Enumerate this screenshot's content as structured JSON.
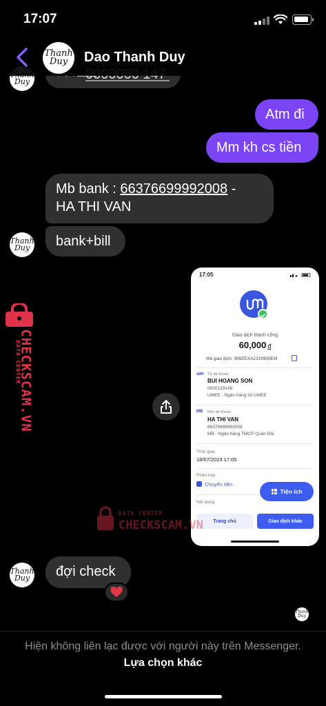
{
  "status_bar": {
    "time": "17:07"
  },
  "header": {
    "contact_name": "Dao Thanh Duy",
    "avatar_line1": "Thanh",
    "avatar_line2": "Duy"
  },
  "messages": [
    {
      "from": "me",
      "text": "Atm đi"
    },
    {
      "from": "me",
      "text": "Mm kh cs tiền"
    },
    {
      "from": "contact",
      "text_prefix": "Mb bank : ",
      "account_number": "66376699992008",
      "text_suffix": " -",
      "text_line2": "HA THI VAN"
    },
    {
      "from": "contact",
      "text": "bank+bill"
    },
    {
      "from": "contact",
      "text": "đợi check",
      "reaction": "❤️"
    }
  ],
  "receipt": {
    "time": "17:05",
    "status": "Giao dịch thành công",
    "amount": "60,000",
    "currency": "đ",
    "transaction_code": "Mã giao dịch: 999ZEXA2319900EM",
    "from_label": "Từ tài khoản",
    "from_name": "BUI HOANG SON",
    "from_account": "0000133149",
    "from_bank": "UMEE - Ngân hàng số UMEE",
    "to_label": "Đến tài khoản",
    "to_name": "HA THI VAN",
    "to_account": "66376699992008",
    "to_bank": "MB - Ngân hàng TMCP Quân Đội",
    "time_label": "Thời gian",
    "time_value": "18/07/2023 17:05",
    "category_label": "Phân loại",
    "category_value": "Chuyển tiền",
    "content_label": "Nội dung",
    "utilities_button": "Tiện ích",
    "home_button": "Trang chủ",
    "other_button": "Giao dịch khác",
    "mini_logo_from": "um",
    "mini_logo_to": "MB"
  },
  "watermark": {
    "brand": "CHECKSCAM.VN",
    "tagline": "DATA CENTER"
  },
  "footer": {
    "text": "Hiện không liên lạc được với người này trên Messenger.",
    "link": "Lựa chọn khác"
  },
  "colors": {
    "outgoing_bubble": "#7b45f5",
    "incoming_bubble": "#303031",
    "accent": "#8b5cf6",
    "watermark": "#e0334a"
  }
}
